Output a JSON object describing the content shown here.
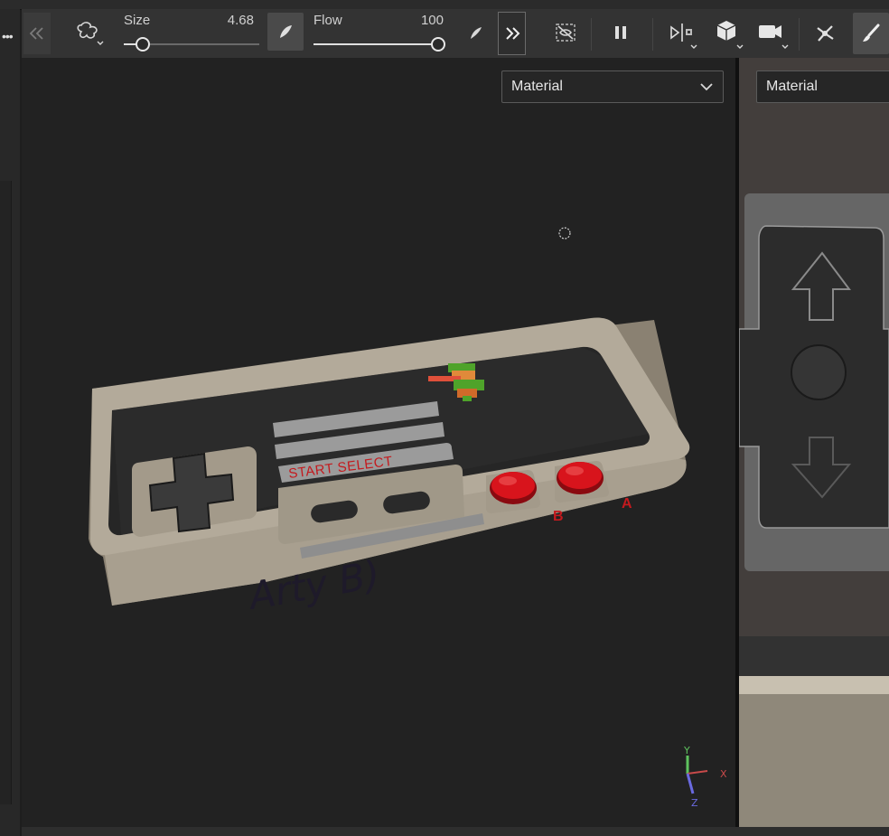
{
  "toolbar": {
    "size_label": "Size",
    "size_value": "4.68",
    "size_level": 0.14,
    "flow_label": "Flow",
    "flow_value": "100",
    "flow_level": 1.0
  },
  "viewport": {
    "material_dropdown": "Material",
    "uv_material_dropdown": "Material",
    "controller": {
      "start_select_label": "START SELECT",
      "button_b": "B",
      "button_a": "A",
      "handwriting": "Arty B)"
    },
    "axes": {
      "y": "Y",
      "x": "X",
      "z": "Z"
    }
  },
  "colors": {
    "toolbar_bg": "#333333",
    "viewport_bg": "#222222",
    "accent_red": "#c8101a",
    "axis_x": "#c84a4a",
    "axis_y": "#5ec25e",
    "axis_z": "#6a6ae0"
  },
  "icons": [
    "collapse-left-icon",
    "brush-shape-icon",
    "pressure-icon",
    "pen-icon",
    "expand-right-icon",
    "hide-mask-icon",
    "pause-icon",
    "symmetry-icon",
    "cube-icon",
    "camera-icon",
    "particles-icon",
    "paint-brush-icon"
  ]
}
